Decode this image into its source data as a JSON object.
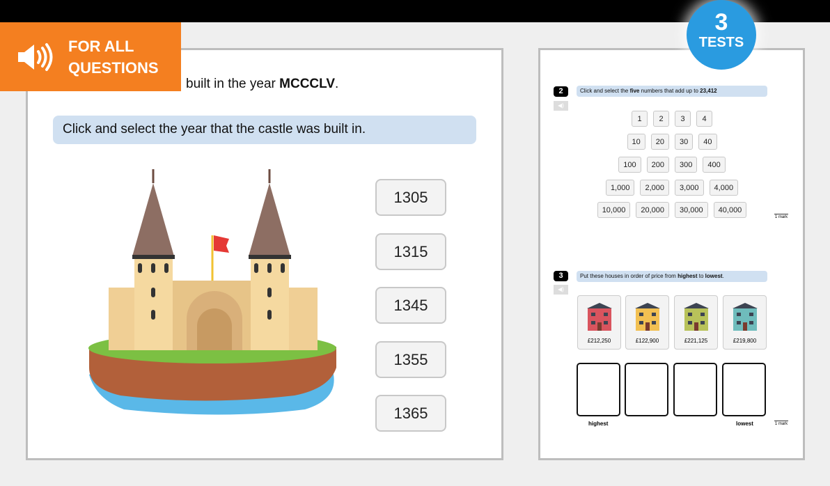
{
  "header": {
    "audio_badge": {
      "line1": "FOR ALL",
      "line2": "QUESTIONS",
      "icon": "speaker-icon"
    },
    "tests_badge": {
      "number": "3",
      "label": "TESTS"
    }
  },
  "left": {
    "question_text": "built in the year ",
    "question_bold": "MCCCLV",
    "question_end": ".",
    "instruction": "Click and select the year that the castle was built in.",
    "options": [
      "1305",
      "1315",
      "1345",
      "1355",
      "1365"
    ]
  },
  "right": {
    "q2": {
      "number": "2",
      "instruction_pre": "Click and select the ",
      "instruction_bold1": "five",
      "instruction_mid": " numbers that add up to ",
      "instruction_bold2": "23,412",
      "rows": [
        [
          "1",
          "2",
          "3",
          "4"
        ],
        [
          "10",
          "20",
          "30",
          "40"
        ],
        [
          "100",
          "200",
          "300",
          "400"
        ],
        [
          "1,000",
          "2,000",
          "3,000",
          "4,000"
        ],
        [
          "10,000",
          "20,000",
          "30,000",
          "40,000"
        ]
      ],
      "mark": "1 mark"
    },
    "q3": {
      "number": "3",
      "instruction_pre": "Put these houses in order of price from ",
      "instruction_bold1": "highest",
      "instruction_mid": " to ",
      "instruction_bold2": "lowest",
      "instruction_end": ".",
      "houses": [
        {
          "price": "£212,250",
          "color": "#d9545e"
        },
        {
          "price": "£122,900",
          "color": "#f2c052"
        },
        {
          "price": "£221,125",
          "color": "#b8c25a"
        },
        {
          "price": "£219,800",
          "color": "#6fbcbc"
        }
      ],
      "label_left": "highest",
      "label_right": "lowest",
      "mark": "1 mark"
    }
  }
}
